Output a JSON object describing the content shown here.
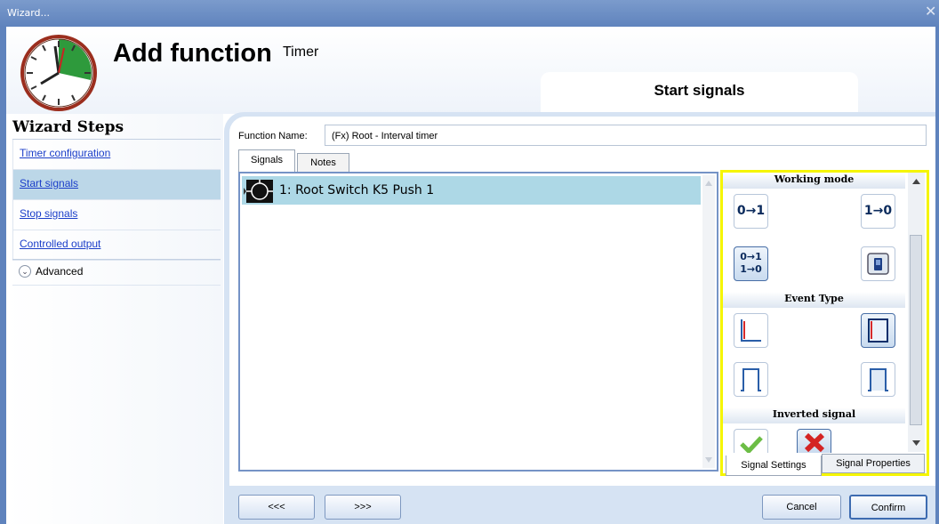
{
  "window": {
    "title": "Wizard...",
    "close_glyph": "✕"
  },
  "header": {
    "title": "Add function",
    "subtitle": "Timer",
    "current_step": "Start signals",
    "logo_icon": "clock-icon"
  },
  "sidebar": {
    "title": "Wizard Steps",
    "items": [
      {
        "label": "Timer configuration",
        "selected": false
      },
      {
        "label": "Start signals",
        "selected": true
      },
      {
        "label": "Stop signals",
        "selected": false
      },
      {
        "label": "Controlled output",
        "selected": false
      }
    ],
    "advanced": {
      "label": "Advanced",
      "icon": "chevron-down-circle-icon",
      "glyph": "⌄"
    }
  },
  "form": {
    "function_name_label": "Function Name:",
    "function_name_value": "(Fx) Root - Interval timer"
  },
  "tabs": [
    {
      "label": "Signals",
      "active": true
    },
    {
      "label": "Notes",
      "active": false
    }
  ],
  "signals": [
    {
      "label": "1: Root Switch K5 Push 1",
      "icon": "push-button-icon",
      "selected": true
    }
  ],
  "settings_panel": {
    "working_mode": {
      "title": "Working mode",
      "options": [
        {
          "label": "0→1",
          "icon": "rising-mode-icon",
          "selected": false
        },
        {
          "label": "1→0",
          "icon": "falling-mode-icon",
          "selected": false
        },
        {
          "label": "0→1 1→0",
          "icon": "both-edges-mode-icon",
          "selected": true
        },
        {
          "label": "",
          "icon": "switch-mode-icon",
          "selected": false
        }
      ]
    },
    "event_type": {
      "title": "Event Type",
      "options": [
        {
          "icon": "edge-event-red-icon",
          "selected": false
        },
        {
          "icon": "edge-event-blue-icon",
          "selected": true
        },
        {
          "icon": "pulse-event-icon",
          "selected": false
        },
        {
          "icon": "pulse-event-blue-icon",
          "selected": false
        }
      ]
    },
    "inverted_signal": {
      "title": "Inverted signal",
      "options": [
        {
          "icon": "check-icon",
          "selected": false
        },
        {
          "icon": "cross-icon",
          "selected": true
        }
      ]
    },
    "tabs": [
      {
        "label": "Signal Settings",
        "active": true
      },
      {
        "label": "Signal Properties",
        "active": false
      }
    ],
    "highlight_color": "#f5f500"
  },
  "footer": {
    "prev": "<<<",
    "next": ">>>",
    "cancel": "Cancel",
    "confirm": "Confirm"
  },
  "colors": {
    "title_bar": "#5f83bd",
    "selected_row": "#add8e6",
    "link": "#1b3ec9"
  }
}
